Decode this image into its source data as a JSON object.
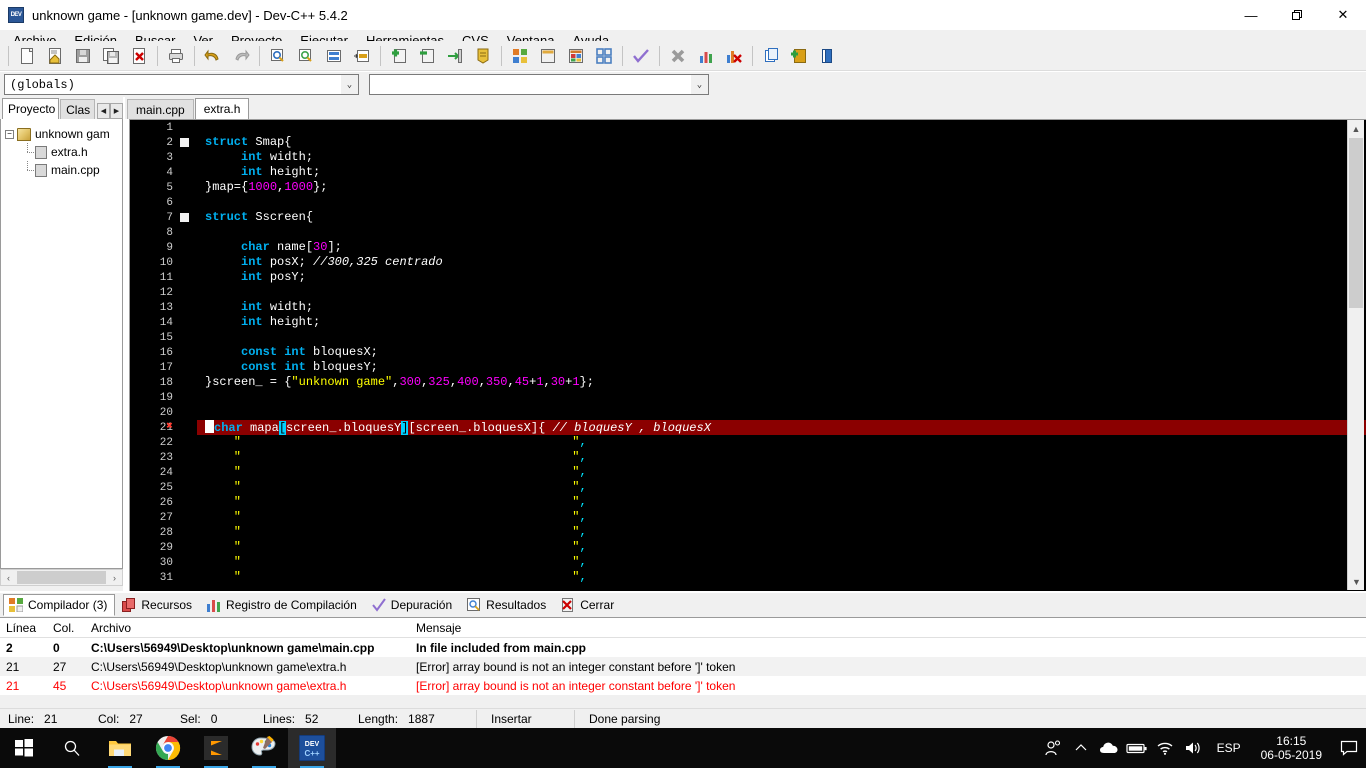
{
  "window": {
    "title": "unknown game - [unknown game.dev] - Dev-C++ 5.4.2",
    "icon": "devcpp-icon",
    "minimize": "—",
    "maximize": "❐",
    "close": "✕"
  },
  "menubar": {
    "items": [
      {
        "label": "Archivo"
      },
      {
        "label": "Edición"
      },
      {
        "label": "Buscar"
      },
      {
        "label": "Ver"
      },
      {
        "label": "Proyecto"
      },
      {
        "label": "Ejecutar"
      },
      {
        "label": "Herramientas"
      },
      {
        "label": "CVS"
      },
      {
        "label": "Ventana"
      },
      {
        "label": "Ayuda"
      }
    ]
  },
  "toolbar": {
    "groups": [
      [
        "new-file-icon",
        "open-file-icon",
        "save-file-icon",
        "save-all-icon",
        "close-file-icon"
      ],
      [
        "print-icon"
      ],
      [
        "undo-icon",
        "redo-icon"
      ],
      [
        "find-icon",
        "find-replace-icon",
        "goto-line-icon",
        "goto-function-icon"
      ],
      [
        "add-to-project-icon",
        "remove-from-project-icon",
        "project-options-icon",
        "project-properties-icon"
      ],
      [
        "compile-icon",
        "run-icon",
        "compile-and-run-icon",
        "rebuild-all-icon"
      ],
      [
        "debug-icon",
        "stop-execution-icon",
        "profile-icon",
        "delete-profile-icon"
      ],
      [
        "insert-icon",
        "toggle-breakpoint-icon",
        "help-icon"
      ]
    ]
  },
  "combos": {
    "scope": {
      "value": "(globals)",
      "placeholder": ""
    },
    "symbol": {
      "value": "",
      "placeholder": ""
    },
    "arrow": "⌄"
  },
  "left_panel": {
    "tabs": [
      {
        "label": "Proyecto",
        "active": true
      },
      {
        "label": "Clas",
        "active": false
      }
    ],
    "spinner": {
      "prev": "◀",
      "next": "▶"
    },
    "tree": {
      "expander": "−",
      "root": "unknown gam",
      "children": [
        "extra.h",
        "main.cpp"
      ]
    },
    "hscroll": {
      "left": "‹",
      "right": "›"
    }
  },
  "editor_tabs": [
    {
      "label": "main.cpp",
      "active": false
    },
    {
      "label": "extra.h",
      "active": true
    }
  ],
  "editor": {
    "first_line": 1,
    "error_line": 21,
    "error_marker": "✖",
    "scroll": {
      "up": "▲",
      "down": "▼"
    },
    "lines": [
      {
        "n": 1,
        "tokens": []
      },
      {
        "n": 2,
        "fold": "start",
        "tokens": [
          {
            "t": "kw",
            "v": "struct"
          },
          {
            "t": "pun",
            "v": " Smap{"
          }
        ]
      },
      {
        "n": 3,
        "tokens": [
          {
            "t": "pun",
            "v": "     "
          },
          {
            "t": "kw",
            "v": "int"
          },
          {
            "t": "pun",
            "v": " width;"
          }
        ]
      },
      {
        "n": 4,
        "tokens": [
          {
            "t": "pun",
            "v": "     "
          },
          {
            "t": "kw",
            "v": "int"
          },
          {
            "t": "pun",
            "v": " height;"
          }
        ]
      },
      {
        "n": 5,
        "tokens": [
          {
            "t": "pun",
            "v": "}map={"
          },
          {
            "t": "num",
            "v": "1000"
          },
          {
            "t": "pun",
            "v": ","
          },
          {
            "t": "num",
            "v": "1000"
          },
          {
            "t": "pun",
            "v": "};"
          }
        ]
      },
      {
        "n": 6,
        "tokens": []
      },
      {
        "n": 7,
        "fold": "start",
        "tokens": [
          {
            "t": "kw",
            "v": "struct"
          },
          {
            "t": "pun",
            "v": " Sscreen{"
          }
        ]
      },
      {
        "n": 8,
        "tokens": []
      },
      {
        "n": 9,
        "tokens": [
          {
            "t": "pun",
            "v": "     "
          },
          {
            "t": "kw",
            "v": "char"
          },
          {
            "t": "pun",
            "v": " name["
          },
          {
            "t": "num",
            "v": "30"
          },
          {
            "t": "pun",
            "v": "];"
          }
        ]
      },
      {
        "n": 10,
        "tokens": [
          {
            "t": "pun",
            "v": "     "
          },
          {
            "t": "kw",
            "v": "int"
          },
          {
            "t": "pun",
            "v": " posX; "
          },
          {
            "t": "cmt",
            "v": "//300,325 centrado"
          }
        ]
      },
      {
        "n": 11,
        "tokens": [
          {
            "t": "pun",
            "v": "     "
          },
          {
            "t": "kw",
            "v": "int"
          },
          {
            "t": "pun",
            "v": " posY;"
          }
        ]
      },
      {
        "n": 12,
        "tokens": []
      },
      {
        "n": 13,
        "tokens": [
          {
            "t": "pun",
            "v": "     "
          },
          {
            "t": "kw",
            "v": "int"
          },
          {
            "t": "pun",
            "v": " width;"
          }
        ]
      },
      {
        "n": 14,
        "tokens": [
          {
            "t": "pun",
            "v": "     "
          },
          {
            "t": "kw",
            "v": "int"
          },
          {
            "t": "pun",
            "v": " height;"
          }
        ]
      },
      {
        "n": 15,
        "tokens": []
      },
      {
        "n": 16,
        "tokens": [
          {
            "t": "pun",
            "v": "     "
          },
          {
            "t": "kw",
            "v": "const int"
          },
          {
            "t": "pun",
            "v": " bloquesX;"
          }
        ]
      },
      {
        "n": 17,
        "tokens": [
          {
            "t": "pun",
            "v": "     "
          },
          {
            "t": "kw",
            "v": "const int"
          },
          {
            "t": "pun",
            "v": " bloquesY;"
          }
        ]
      },
      {
        "n": 18,
        "tokens": [
          {
            "t": "pun",
            "v": "}screen_ = {"
          },
          {
            "t": "str",
            "v": "\"unknown game\""
          },
          {
            "t": "pun",
            "v": ","
          },
          {
            "t": "num",
            "v": "300"
          },
          {
            "t": "pun",
            "v": ","
          },
          {
            "t": "num",
            "v": "325"
          },
          {
            "t": "pun",
            "v": ","
          },
          {
            "t": "num",
            "v": "400"
          },
          {
            "t": "pun",
            "v": ","
          },
          {
            "t": "num",
            "v": "350"
          },
          {
            "t": "pun",
            "v": ","
          },
          {
            "t": "num",
            "v": "45"
          },
          {
            "t": "pun",
            "v": "+"
          },
          {
            "t": "num",
            "v": "1"
          },
          {
            "t": "pun",
            "v": ","
          },
          {
            "t": "num",
            "v": "30"
          },
          {
            "t": "pun",
            "v": "+"
          },
          {
            "t": "num",
            "v": "1"
          },
          {
            "t": "pun",
            "v": "};"
          }
        ]
      },
      {
        "n": 19,
        "tokens": []
      },
      {
        "n": 20,
        "tokens": []
      },
      {
        "n": 21,
        "error": true,
        "caret": true,
        "tokens": [
          {
            "t": "kw",
            "v": "char"
          },
          {
            "t": "pun",
            "v": " mapa"
          },
          {
            "t": "brhl",
            "v": "["
          },
          {
            "t": "pun",
            "v": "screen_.bloquesY"
          },
          {
            "t": "brhl",
            "v": "]"
          },
          {
            "t": "pun",
            "v": "[screen_.bloquesX]{ "
          },
          {
            "t": "cmt",
            "v": "// bloquesY , bloquesX"
          }
        ]
      },
      {
        "n": 22,
        "blank_string": true
      },
      {
        "n": 23,
        "blank_string": true
      },
      {
        "n": 24,
        "blank_string": true
      },
      {
        "n": 25,
        "blank_string": true
      },
      {
        "n": 26,
        "blank_string": true
      },
      {
        "n": 27,
        "blank_string": true
      },
      {
        "n": 28,
        "blank_string": true
      },
      {
        "n": 29,
        "blank_string": true
      },
      {
        "n": 30,
        "blank_string": true
      },
      {
        "n": 31,
        "blank_string": true
      }
    ],
    "string_row": {
      "quote": "\"",
      "comma": ","
    }
  },
  "bottom_panel": {
    "tabs": [
      {
        "label": "Compilador (3)",
        "icon": "compiler-icon",
        "active": true
      },
      {
        "label": "Recursos",
        "icon": "resources-icon",
        "active": false
      },
      {
        "label": "Registro de Compilación",
        "icon": "build-log-icon",
        "active": false
      },
      {
        "label": "Depuración",
        "icon": "debug-check-icon",
        "active": false
      },
      {
        "label": "Resultados",
        "icon": "find-results-icon",
        "active": false
      },
      {
        "label": "Cerrar",
        "icon": "close-panel-icon",
        "active": false
      }
    ],
    "columns": [
      "Línea",
      "Col.",
      "Archivo",
      "Mensaje"
    ],
    "rows": [
      {
        "line": "2",
        "col": "0",
        "file": "C:\\Users\\56949\\Desktop\\unknown game\\main.cpp",
        "message": "In file included from main.cpp",
        "style": "bold"
      },
      {
        "line": "21",
        "col": "27",
        "file": "C:\\Users\\56949\\Desktop\\unknown game\\extra.h",
        "message": "[Error] array bound is not an integer constant before ']' token",
        "style": "normal"
      },
      {
        "line": "21",
        "col": "45",
        "file": "C:\\Users\\56949\\Desktop\\unknown game\\extra.h",
        "message": "[Error] array bound is not an integer constant before ']' token",
        "style": "error"
      }
    ]
  },
  "statusbar": {
    "line_label": "Line:",
    "line_value": "21",
    "col_label": "Col:",
    "col_value": "27",
    "sel_label": "Sel:",
    "sel_value": "0",
    "lines_label": "Lines:",
    "lines_value": "52",
    "length_label": "Length:",
    "length_value": "1887",
    "mode": "Insertar",
    "parse_status": "Done parsing"
  },
  "taskbar": {
    "start": "start-button-icon",
    "search": "search-icon",
    "apps": [
      {
        "name": "file-explorer-icon",
        "running": true,
        "active": false
      },
      {
        "name": "google-chrome-icon",
        "running": true,
        "active": false
      },
      {
        "name": "sublime-text-icon",
        "running": true,
        "active": false
      },
      {
        "name": "paint-icon",
        "running": true,
        "active": false
      },
      {
        "name": "devcpp-icon",
        "running": true,
        "active": true
      }
    ],
    "tray": {
      "people": "people-icon",
      "chevron": "∧",
      "onedrive": "onedrive-icon",
      "battery": "battery-icon",
      "wifi": "wifi-icon",
      "volume": "volume-icon",
      "language": "ESP",
      "time": "16:15",
      "date": "06-05-2019",
      "notifications": "notification-icon"
    }
  },
  "colors": {
    "keyword": "#00b0f0",
    "string": "#ffff00",
    "number": "#ff00ff",
    "error_line_bg": "#8b0000",
    "bracket_highlight": "#00d0ff",
    "accent": "#3ba7e8"
  }
}
